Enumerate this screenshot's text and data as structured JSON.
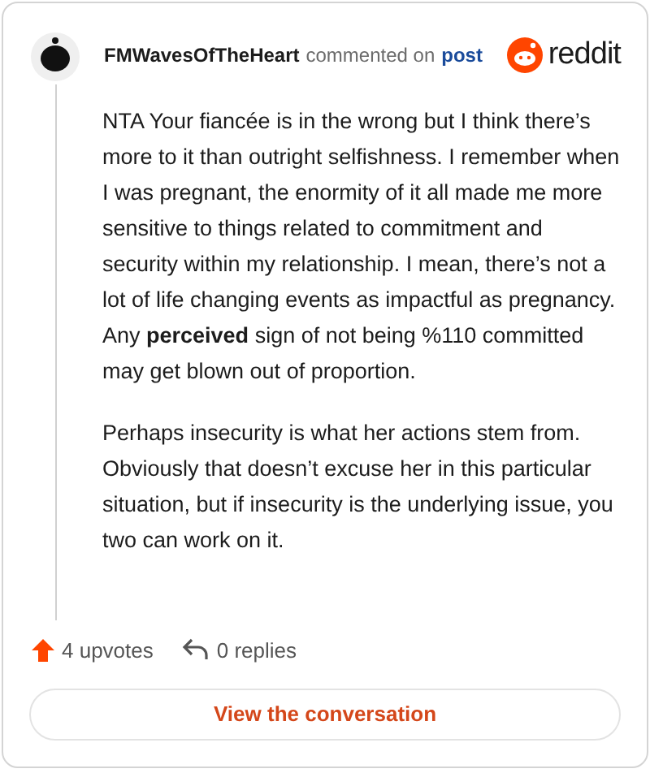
{
  "comment": {
    "author": "FMWavesOfTheHeart",
    "action": "commented on",
    "link": "post",
    "brand": "reddit",
    "paragraphs": [
      "NTA Your fiancée is in the wrong but I think there’s more to it than outright selfishness. I remember when I was pregnant, the enormity of it all made me more sensitive to things related to commitment and security within my relationship. I mean, there’s not a lot of life changing events as impactful as pregnancy. Any **perceived** sign of not being %110 committed may get blown out of proportion.",
      "Perhaps insecurity is what her actions stem from. Obviously that doesn’t excuse her in this particular situation, but if insecurity is the underlying issue, you two can work on it."
    ]
  },
  "footer": {
    "upvotes": "4 upvotes",
    "replies": "0 replies"
  },
  "button": "View the conversation"
}
